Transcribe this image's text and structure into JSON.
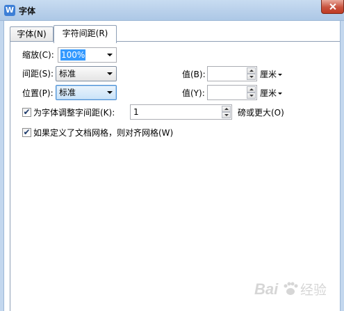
{
  "window": {
    "title": "字体",
    "app_icon_letter": "W",
    "accent_color": "#3d7fd6"
  },
  "tabs": [
    {
      "label": "字体(N)",
      "selected": false
    },
    {
      "label": "字符间距(R)",
      "selected": true
    }
  ],
  "spacing": {
    "scale": {
      "label": "缩放(C):",
      "value": "100%"
    },
    "spacing": {
      "label": "间距(S):",
      "value": "标准",
      "amount_label": "值(B):",
      "amount_value": "",
      "unit": "厘米"
    },
    "position": {
      "label": "位置(P):",
      "value": "标准",
      "amount_label": "值(Y):",
      "amount_value": "",
      "unit": "厘米"
    },
    "kerning": {
      "label": "为字体调整字间距(K):",
      "checked": true,
      "value": "1",
      "suffix": "磅或更大(O)"
    },
    "grid": {
      "label": "如果定义了文档网格，则对齐网格(W)",
      "checked": true
    }
  },
  "watermark": {
    "text": "Bai",
    "text2": "经验",
    "icon": "paw-icon"
  }
}
